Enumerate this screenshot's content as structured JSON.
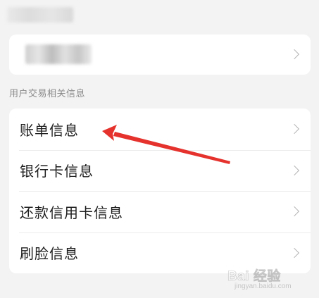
{
  "header": {
    "title_blurred": true
  },
  "account_card": {
    "name_blurred": true
  },
  "section": {
    "label": "用户交易相关信息"
  },
  "items": [
    {
      "label": "账单信息"
    },
    {
      "label": "银行卡信息"
    },
    {
      "label": "还款信用卡信息"
    },
    {
      "label": "刷脸信息"
    }
  ],
  "annotation": {
    "type": "arrow",
    "color": "#e5322d",
    "points_to": "账单信息"
  },
  "watermark": {
    "logo": "Bai 经验",
    "url": "jingyan.baidu.com"
  },
  "colors": {
    "background": "#f3f3f3",
    "card": "#ffffff",
    "section_label": "#8a8a8a",
    "chevron": "#b5b5b5",
    "arrow": "#e5322d"
  }
}
